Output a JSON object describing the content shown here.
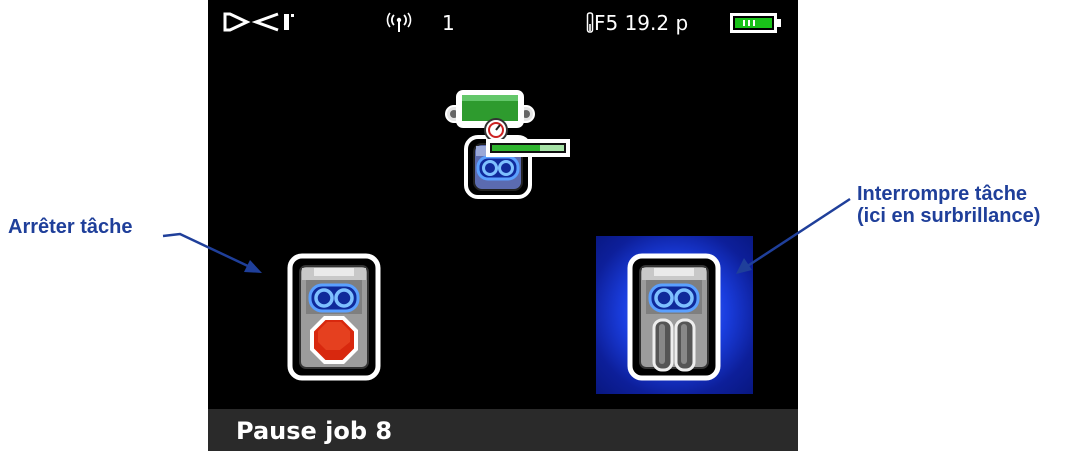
{
  "callouts": {
    "left": "Arrêter tâche",
    "right_line1": "Interrompre tâche",
    "right_line2": "(ici en surbrillance)"
  },
  "statusbar": {
    "logo_icon": "dci-logo-icon",
    "signal_icon": "antenna-signal-icon",
    "signal_text": "1",
    "thermometer_icon": "thermometer-icon",
    "frequency_text": "F5 19.2 p",
    "battery_icon": "battery-icon"
  },
  "icons": {
    "top": "locator-transmitter-pressure-icon",
    "left": "stop-job-icon",
    "right": "pause-job-icon"
  },
  "colors": {
    "callout_text": "#1f3f9a",
    "highlight": "#1a3ee0",
    "battery": "#19c219",
    "stop": "#e32a12"
  },
  "bottombar": {
    "label": "Pause job 8"
  }
}
